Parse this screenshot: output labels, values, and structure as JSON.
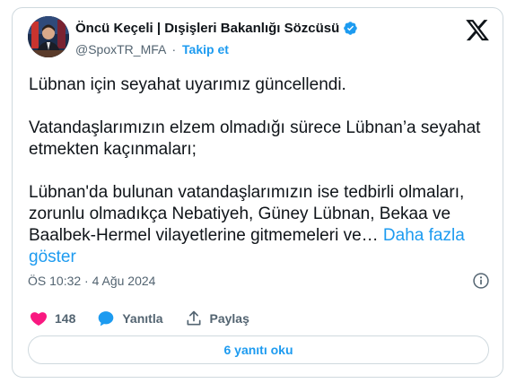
{
  "author": {
    "name": "Öncü Keçeli | Dışişleri Bakanlığı Sözcüsü",
    "handle": "@SpoxTR_MFA",
    "separator": "·",
    "follow_label": "Takip et"
  },
  "icons": {
    "avatar": "avatar-photo",
    "verified": "verified-badge-icon",
    "logo": "x-logo-icon",
    "info": "info-icon",
    "like": "heart-icon",
    "reply": "speech-bubble-icon",
    "share": "share-upload-icon"
  },
  "colors": {
    "accent": "#1d9bf0",
    "like": "#f91880",
    "text": "#0f1419",
    "muted": "#536471",
    "border": "#cfd9de"
  },
  "tweet": {
    "paragraph_1": "Lübnan için seyahat uyarımız güncellendi.",
    "paragraph_2": "Vatandaşlarımızın elzem olmadığı sürece Lübnan’a seyahat etmekten kaçınmaları;",
    "paragraph_3": "Lübnan'da bulunan vatandaşlarımızın ise tedbirli olmaları, zorunlu olmadıkça Nebatiyeh, Güney Lübnan, Bekaa ve Baalbek-Hermel vilayetlerine gitmemeleri ve…",
    "show_more": "Daha fazla göster",
    "timestamp": "ÖS 10:32 · 4 Ağu 2024"
  },
  "actions": {
    "like_count": "148",
    "reply_label": "Yanıtla",
    "share_label": "Paylaş"
  },
  "replies_button": "6 yanıtı oku"
}
